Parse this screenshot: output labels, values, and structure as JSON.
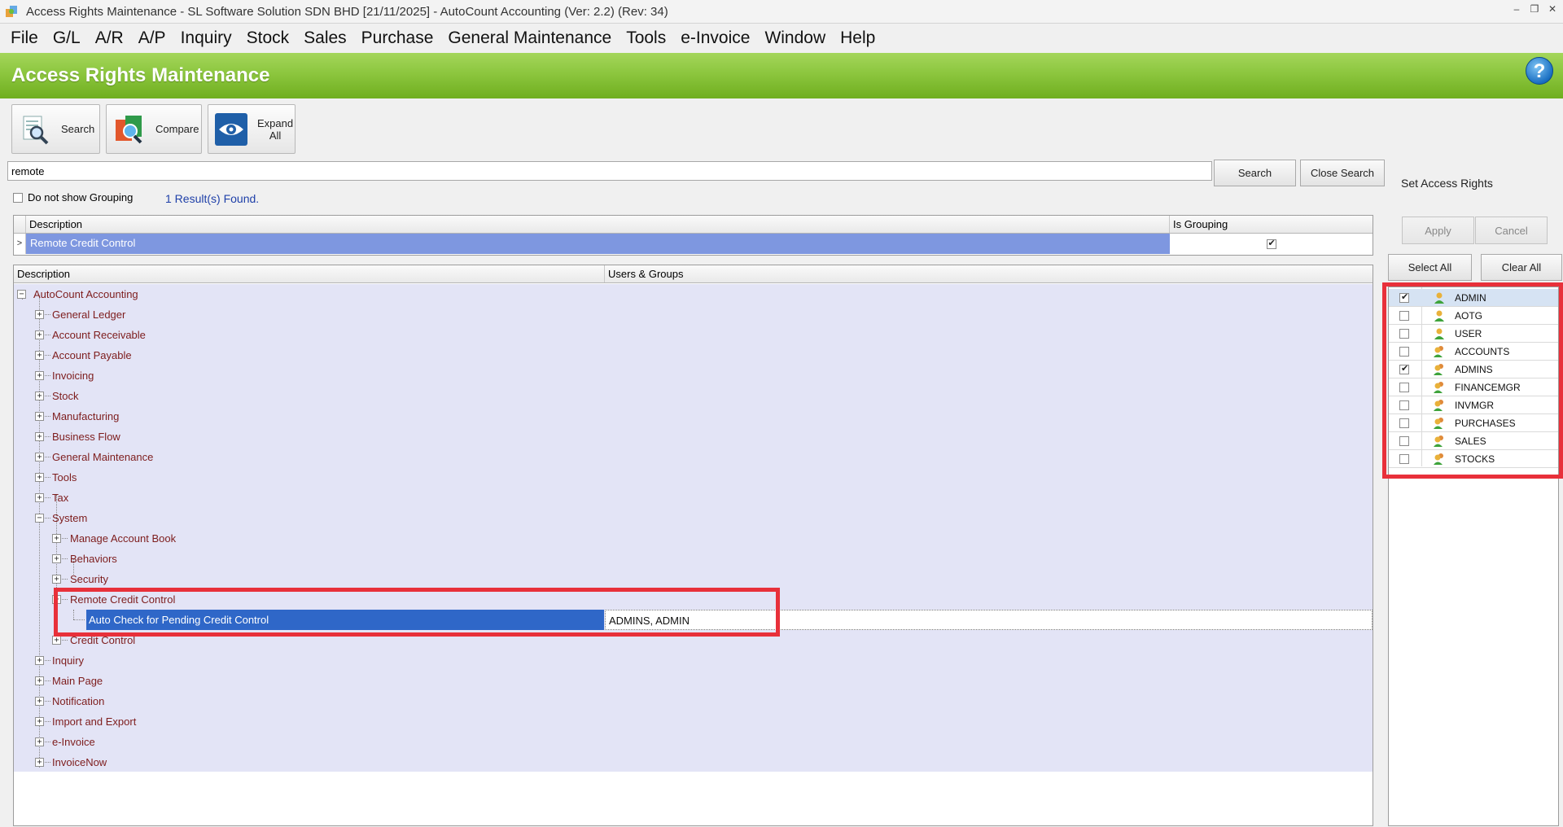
{
  "window": {
    "title": "Access Rights Maintenance - SL Software Solution SDN BHD [21/11/2025] - AutoCount Accounting (Ver: 2.2) (Rev: 34)",
    "minimize": "–",
    "restore": "❐",
    "close": "✕"
  },
  "menu": [
    "File",
    "G/L",
    "A/R",
    "A/P",
    "Inquiry",
    "Stock",
    "Sales",
    "Purchase",
    "General Maintenance",
    "Tools",
    "e-Invoice",
    "Window",
    "Help"
  ],
  "header": {
    "title": "Access Rights Maintenance",
    "help_glyph": "?"
  },
  "toolbar": {
    "search_label": "Search",
    "compare_label": "Compare",
    "expand_label_1": "Expand",
    "expand_label_2": "All"
  },
  "search": {
    "value": "remote",
    "search_button": "Search",
    "close_button": "Close Search",
    "no_grouping_label": "Do not show Grouping",
    "result_text": "1 Result(s) Found."
  },
  "results_grid": {
    "columns": [
      "Description",
      "Is Grouping"
    ],
    "indicator": ">",
    "rows": [
      {
        "description": "Remote Credit Control",
        "is_grouping": true
      }
    ]
  },
  "tree": {
    "columns": [
      "Description",
      "Users & Groups"
    ],
    "root": "AutoCount Accounting",
    "level1_top": [
      "General Ledger",
      "Account Receivable",
      "Account Payable",
      "Invoicing",
      "Stock",
      "Manufacturing",
      "Business Flow",
      "General Maintenance",
      "Tools",
      "Tax",
      "System"
    ],
    "system_children": [
      "Manage Account Book",
      "Behaviors",
      "Security",
      "Remote Credit Control"
    ],
    "selected_item": "Auto Check for Pending Credit Control",
    "selected_users": "ADMINS, ADMIN",
    "after_selected": "Credit Control",
    "level1_bottom": [
      "Inquiry",
      "Main Page",
      "Notification",
      "Import and Export",
      "e-Invoice",
      "InvoiceNow"
    ],
    "plus": "+",
    "minus": "−"
  },
  "rights_panel": {
    "title": "Set Access Rights",
    "apply": "Apply",
    "cancel": "Cancel",
    "select_all": "Select All",
    "clear_all": "Clear All",
    "users": [
      {
        "name": "ADMIN",
        "checked": true,
        "kind": "user"
      },
      {
        "name": "AOTG",
        "checked": false,
        "kind": "user"
      },
      {
        "name": "USER",
        "checked": false,
        "kind": "user"
      },
      {
        "name": "ACCOUNTS",
        "checked": false,
        "kind": "group"
      },
      {
        "name": "ADMINS",
        "checked": true,
        "kind": "group"
      },
      {
        "name": "FINANCEMGR",
        "checked": false,
        "kind": "group"
      },
      {
        "name": "INVMGR",
        "checked": false,
        "kind": "group"
      },
      {
        "name": "PURCHASES",
        "checked": false,
        "kind": "group"
      },
      {
        "name": "SALES",
        "checked": false,
        "kind": "group"
      },
      {
        "name": "STOCKS",
        "checked": false,
        "kind": "group"
      }
    ]
  },
  "colors": {
    "header_green": "#8cc63e",
    "selection_blue": "#2f67c8",
    "result_highlight": "#7e97e0",
    "tree_bg": "#e3e4f6",
    "tree_text": "#7d1c1c",
    "annotation_red": "#e8303a"
  }
}
